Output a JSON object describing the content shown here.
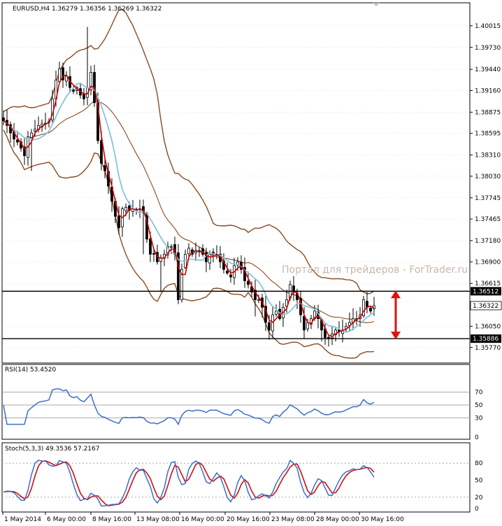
{
  "colors": {
    "background": "#ffffff",
    "frame": "#000000",
    "grid": "#c8c8c8",
    "candle": "#000000",
    "bollinger": "#8b4a22",
    "ma_fast": "#cc0000",
    "ma_slow": "#87c4da",
    "level_line": "#000000",
    "level_tag_bg": "#000000",
    "level_tag_text": "#ffffff",
    "arrow": "#e01010",
    "rsi": "#3d6ec9",
    "stoch_main": "#3d6ec9",
    "stoch_signal": "#d01010",
    "watermark": "#c9b7a6"
  },
  "chart_data": [
    {
      "type": "candlestick",
      "title": "EURUSD,H4  1.36279 1.36356 1.36269 1.36322",
      "ylim": [
        1.3562,
        1.4018
      ],
      "y_ticks": [
        "1.40015",
        "1.39730",
        "1.39440",
        "1.39160",
        "1.38875",
        "1.38595",
        "1.38310",
        "1.38030",
        "1.37745",
        "1.37465",
        "1.37180",
        "1.36900",
        "1.36615",
        "1.36322",
        "1.36050",
        "1.35770"
      ],
      "x_tick_labels": [
        "1 May 2014",
        "6 May 00:00",
        "8 May 16:00",
        "13 May 08:00",
        "16 May 00:00",
        "20 May 16:00",
        "23 May 08:00",
        "28 May 00:00",
        "30 May 16:00"
      ],
      "close": [
        1.3876,
        1.387,
        1.386,
        1.3852,
        1.3848,
        1.384,
        1.383,
        1.3855,
        1.386,
        1.3865,
        1.387,
        1.3872,
        1.3873,
        1.3875,
        1.3905,
        1.393,
        1.3945,
        1.393,
        1.3935,
        1.392,
        1.3915,
        1.392,
        1.391,
        1.3905,
        1.392,
        1.394,
        1.39,
        1.385,
        1.382,
        1.381,
        1.379,
        1.377,
        1.375,
        1.3735,
        1.376,
        1.3762,
        1.3758,
        1.376,
        1.3758,
        1.376,
        1.3755,
        1.372,
        1.37,
        1.37,
        1.369,
        1.3695,
        1.37,
        1.371,
        1.371,
        1.37,
        1.364,
        1.368,
        1.37,
        1.3708,
        1.37,
        1.3705,
        1.3705,
        1.37,
        1.369,
        1.37,
        1.37,
        1.37,
        1.369,
        1.368,
        1.3675,
        1.367,
        1.3685,
        1.369,
        1.368,
        1.3665,
        1.366,
        1.365,
        1.364,
        1.364,
        1.363,
        1.361,
        1.36,
        1.362,
        1.3625,
        1.3615,
        1.363,
        1.364,
        1.366,
        1.365,
        1.364,
        1.362,
        1.36,
        1.361,
        1.3615,
        1.3625,
        1.3615,
        1.36,
        1.359,
        1.359,
        1.3595,
        1.36,
        1.3598,
        1.36,
        1.3605,
        1.361,
        1.3615,
        1.3615,
        1.362,
        1.364,
        1.363,
        1.3625,
        1.3632
      ],
      "levels": [
        {
          "price": 1.36512,
          "label": "1.36512"
        },
        {
          "price": 1.35886,
          "label": "1.35886"
        }
      ],
      "current_price_label": "1.36322",
      "watermark": "Портал для трейдеров - ForTrader.ru",
      "indicators": [
        "Bollinger Bands",
        "Moving Average (fast)",
        "Moving Average (slow)"
      ],
      "arrow": {
        "from_price": 1.36512,
        "to_price": 1.35886
      }
    },
    {
      "type": "line",
      "title": "RSI(14) 53.4520",
      "ylim": [
        0,
        100
      ],
      "y_ticks": [
        "70",
        "50",
        "30",
        "0"
      ],
      "levels": [
        70,
        50,
        30
      ]
    },
    {
      "type": "line",
      "title": "Stoch(5,3,3) 49.3536 57.2167",
      "ylim": [
        0,
        100
      ],
      "y_ticks": [
        "80",
        "50",
        "20",
        "0"
      ],
      "levels": [
        80,
        20
      ],
      "series": [
        {
          "name": "Main",
          "color": "#3d6ec9"
        },
        {
          "name": "Signal",
          "color": "#d01010"
        }
      ]
    }
  ]
}
